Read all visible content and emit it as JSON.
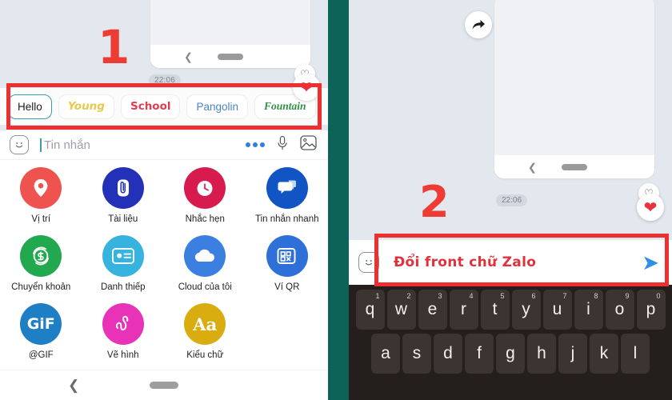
{
  "left_panel": {
    "marker": "1",
    "chat": {
      "timestamp": "22:06",
      "reaction_outline_icon": "heart-outline-icon",
      "reaction_filled_icon": "heart-filled-icon",
      "thumb_back_icon": "chevron-left-icon",
      "thumb_home_icon": "home-pill-icon"
    },
    "font_chips": [
      {
        "label": "Hello",
        "style": "c-hello",
        "selected": true,
        "color": "#1c1c1c"
      },
      {
        "label": "Young",
        "style": "c-young",
        "selected": false,
        "color": "#e8c94a"
      },
      {
        "label": "School",
        "style": "c-school",
        "selected": false,
        "color": "#e23b4e"
      },
      {
        "label": "Pangolin",
        "style": "c-pangolin",
        "selected": false,
        "color": "#4a86c7"
      },
      {
        "label": "Fountain",
        "style": "c-fountain",
        "selected": false,
        "color": "#2f9044"
      }
    ],
    "input_bar": {
      "placeholder": "Tin nhắn",
      "emoji_icon": "emoji-smiley-icon",
      "more_icon": "more-dots-icon",
      "mic_icon": "microphone-icon",
      "image_icon": "image-picker-icon"
    },
    "app_grid": [
      {
        "label": "Vị trí",
        "icon": "location-pin-icon",
        "color": "#ef5350"
      },
      {
        "label": "Tài liệu",
        "icon": "paperclip-icon",
        "color": "#2330b8"
      },
      {
        "label": "Nhắc hẹn",
        "icon": "clock-reminder-icon",
        "color": "#d81b4e"
      },
      {
        "label": "Tin nhắn nhanh",
        "icon": "quick-reply-icon",
        "color": "#1155c4"
      },
      {
        "label": "Chuyển khoản",
        "icon": "money-transfer-icon",
        "color": "#22a84f"
      },
      {
        "label": "Danh thiếp",
        "icon": "contact-card-icon",
        "color": "#36b3de"
      },
      {
        "label": "Cloud của tôi",
        "icon": "cloud-icon",
        "color": "#3b7fe0"
      },
      {
        "label": "Ví QR",
        "icon": "qr-wallet-icon",
        "color": "#2f6fd8"
      },
      {
        "label": "@GIF",
        "icon": "gif-icon",
        "color": "#1e7fc4"
      },
      {
        "label": "Vẽ hình",
        "icon": "doodle-icon",
        "color": "#e832b8"
      },
      {
        "label": "Kiểu chữ",
        "icon": "font-style-icon",
        "color": "#d9ad10"
      }
    ],
    "nav_bar": {
      "back_icon": "chevron-left-icon",
      "home_icon": "home-pill-icon"
    }
  },
  "right_panel": {
    "marker": "2",
    "forward_icon": "forward-arrow-icon",
    "chat": {
      "timestamp": "22:06",
      "reaction_outline_icon": "heart-outline-icon",
      "reaction_filled_icon": "heart-filled-icon",
      "thumb_back_icon": "chevron-left-icon",
      "thumb_home_icon": "home-pill-icon"
    },
    "input_bar": {
      "typed_text": "Đổi front chữ Zalo",
      "emoji_icon": "emoji-smiley-icon",
      "send_icon": "send-arrow-icon"
    },
    "keyboard": {
      "row1": [
        {
          "key": "q",
          "sup": "1"
        },
        {
          "key": "w",
          "sup": "2"
        },
        {
          "key": "e",
          "sup": "3"
        },
        {
          "key": "r",
          "sup": "4"
        },
        {
          "key": "t",
          "sup": "5"
        },
        {
          "key": "y",
          "sup": "6"
        },
        {
          "key": "u",
          "sup": "7"
        },
        {
          "key": "i",
          "sup": "8"
        },
        {
          "key": "o",
          "sup": "9"
        },
        {
          "key": "p",
          "sup": "0"
        }
      ],
      "row2": [
        {
          "key": "a",
          "sup": ""
        },
        {
          "key": "s",
          "sup": ""
        },
        {
          "key": "d",
          "sup": ""
        },
        {
          "key": "f",
          "sup": ""
        },
        {
          "key": "g",
          "sup": ""
        },
        {
          "key": "h",
          "sup": ""
        },
        {
          "key": "j",
          "sup": ""
        },
        {
          "key": "k",
          "sup": ""
        },
        {
          "key": "l",
          "sup": ""
        }
      ]
    }
  },
  "colors": {
    "chat_background": "#e2e8ee",
    "divider": "#0d6358",
    "annotation_red": "#ed2f2f",
    "accent_blue": "#2f8fe8",
    "keyboard_bg": "#241f1c",
    "key_bg": "#3b3430"
  }
}
